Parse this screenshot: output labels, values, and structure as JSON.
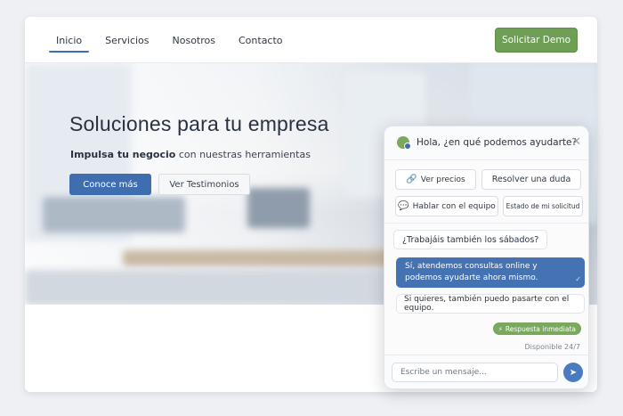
{
  "header": {
    "nav": [
      "Inicio",
      "Servicios",
      "Nosotros",
      "Contacto"
    ],
    "cta_label": "Solicitar Demo"
  },
  "hero": {
    "title": "Soluciones para tu empresa",
    "subtitle_bold": "Impulsa tu negocio",
    "subtitle_rest": " con nuestras herramientas",
    "primary_label": "Conoce más",
    "secondary_label": "Ver Testimonios"
  },
  "chat": {
    "greeting": "Hola, ¿en qué podemos ayudarte?",
    "close_glyph": "✕",
    "quick_replies": [
      {
        "label": "Ver precios",
        "icon": "link-icon"
      },
      {
        "label": "Resolver una duda",
        "icon": ""
      },
      {
        "label": "Hablar con el equipo",
        "icon": "chat-bubble-icon"
      },
      {
        "label": "Estado de mi solicitud",
        "icon": ""
      }
    ],
    "user_message": "¿Trabajáis también los sábados?",
    "agent_reply": "Sí, atendemos consultas online y podemos ayudarte ahora mismo.",
    "agent_followup": "Si quieres, también puedo pasarte con el equipo.",
    "badge": "Respuesta inmediata",
    "availability": "Disponible 24/7",
    "input_placeholder": "Escribe un mensaje..."
  },
  "colors": {
    "primary": "#3e6db0",
    "accent_green": "#6e9f55",
    "chat_out_bubble": "#4572b3"
  }
}
